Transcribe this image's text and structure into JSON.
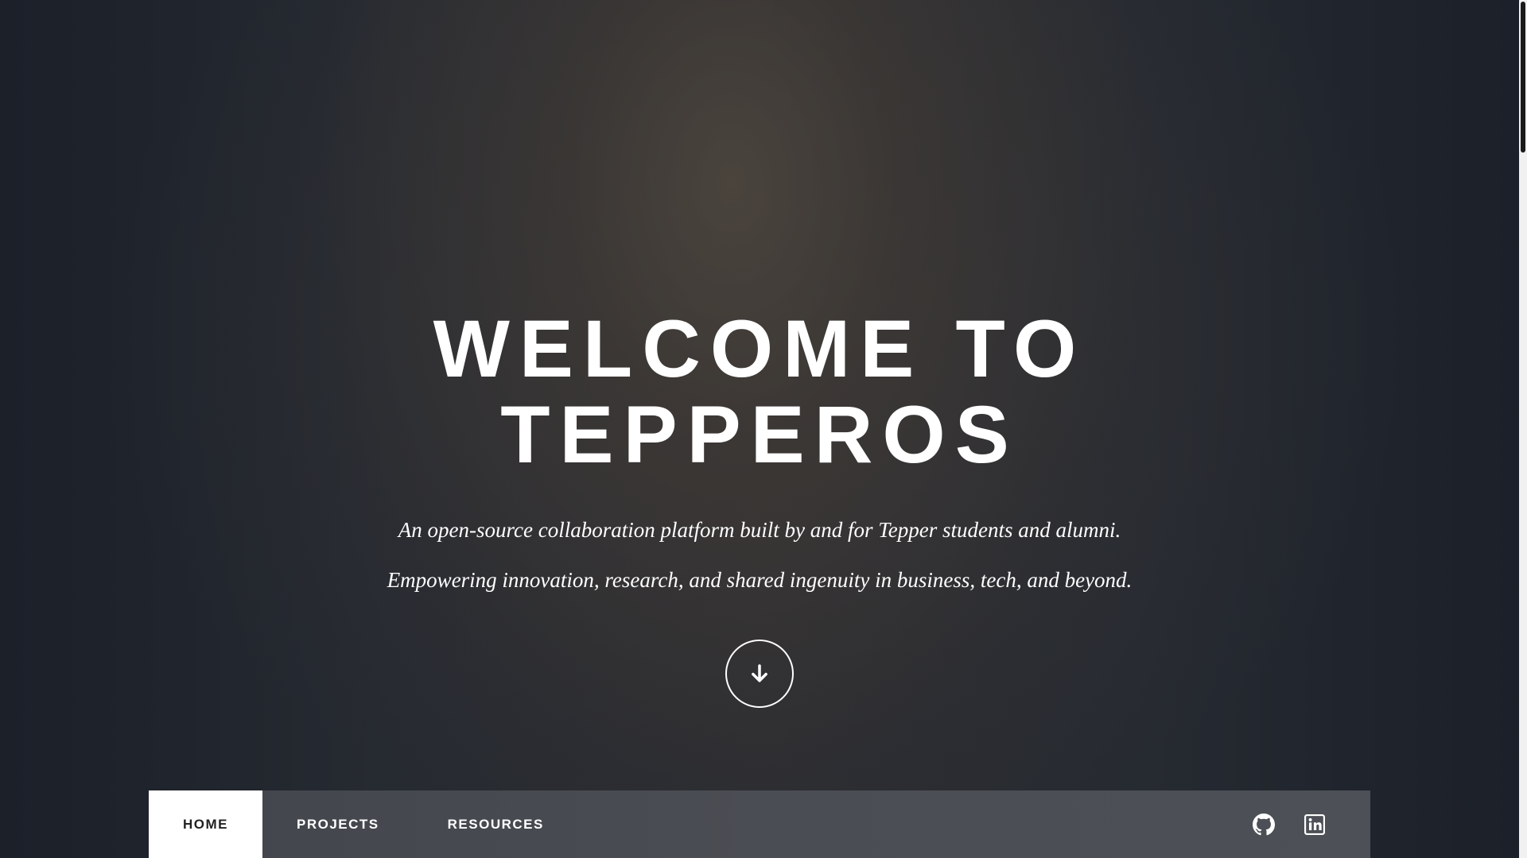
{
  "hero": {
    "title_line1": "WELCOME TO",
    "title_line2": "TEPPEROS",
    "tagline_1": "An open-source collaboration platform built by and for Tepper students and alumni.",
    "tagline_2": "Empowering innovation, research, and shared ingenuity in business, tech, and beyond.",
    "scroll_icon": "arrow-down-icon"
  },
  "nav": {
    "items": [
      {
        "label": "HOME",
        "active": true
      },
      {
        "label": "PROJECTS",
        "active": false
      },
      {
        "label": "RESOURCES",
        "active": false
      }
    ],
    "icons": [
      "github-icon",
      "linkedin-icon"
    ]
  },
  "colors": {
    "text": "#ffffff",
    "nav_bg": "#4a4d53",
    "nav_active_bg": "#ffffff",
    "nav_active_text": "#222222"
  }
}
